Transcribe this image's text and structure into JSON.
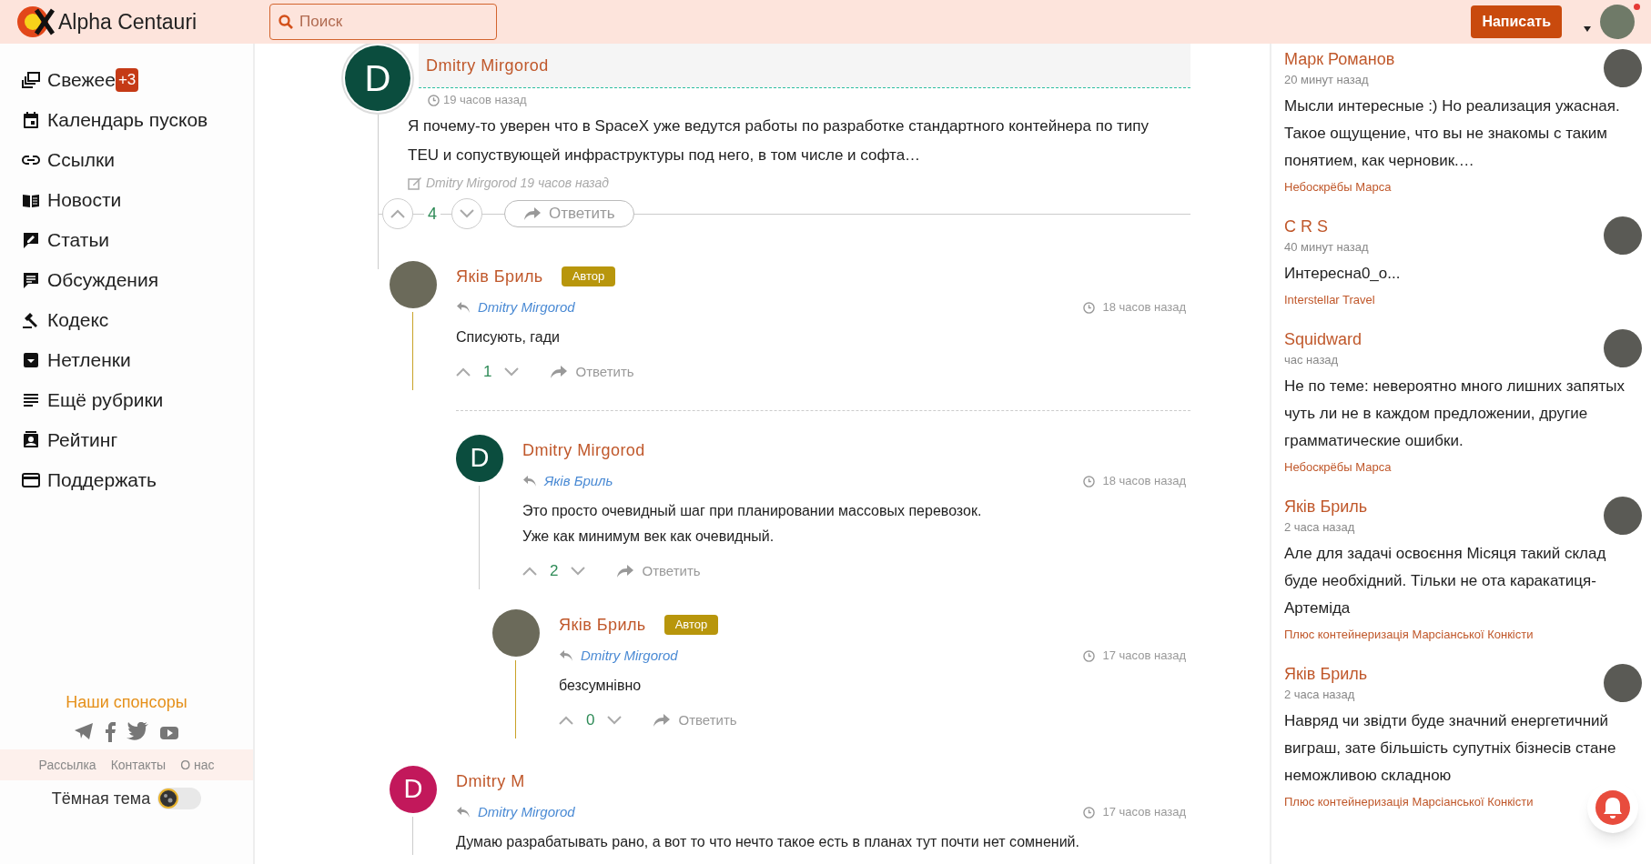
{
  "header": {
    "logo_text": "Alpha Centauri",
    "search": {
      "placeholder": "Поиск"
    },
    "write_button": "Написать",
    "has_notification": true
  },
  "sidebar": {
    "items": [
      {
        "label": "Свежее",
        "badge": "+3"
      },
      {
        "label": "Календарь пусков"
      },
      {
        "label": "Ссылки"
      },
      {
        "label": "Новости"
      },
      {
        "label": "Статьи"
      },
      {
        "label": "Обсуждения"
      },
      {
        "label": "Кодекс"
      },
      {
        "label": "Нетленки"
      },
      {
        "label": "Ещё рубрики"
      },
      {
        "label": "Рейтинг"
      },
      {
        "label": "Поддержать"
      }
    ],
    "sponsors_title": "Наши спонсоры",
    "footer_links": [
      "Рассылка",
      "Контакты",
      "О нас"
    ],
    "dark_theme": {
      "label": "Тёмная тема",
      "on": false
    }
  },
  "comments": [
    {
      "kind": "root",
      "author": "Dmitry Mirgorod",
      "avatar": {
        "kind": "letter",
        "letter": "D",
        "color": "#0b4d3e"
      },
      "time": "19 часов назад",
      "text": "Я почему-то уверен что в SpaceX уже ведутся работы по разработке стандартного контейнера по типу TEU и сопуствующей инфраструктуры под него, в том числе и софта…",
      "edited": "Dmitry Mirgorod 19 часов назад",
      "votes": "4",
      "reply_label": "Ответить",
      "children": [
        {
          "kind": "reply",
          "author": "Яків Бриль",
          "badge": "Автор",
          "avatar": {
            "kind": "photo"
          },
          "reply_to": "Dmitry Mirgorod",
          "time": "18 часов назад",
          "text": "Списують, гади",
          "votes": "1",
          "reply_label": "Ответить",
          "children": [
            {
              "kind": "reply",
              "author": "Dmitry Mirgorod",
              "avatar": {
                "kind": "letter",
                "letter": "D",
                "color": "#0b4d3e"
              },
              "reply_to": "Яків Бриль",
              "time": "18 часов назад",
              "text": "Это просто очевидный шаг при планировании массовых перевозок.\nУже как минимум век как очевидный.",
              "votes": "2",
              "reply_label": "Ответить",
              "children": [
                {
                  "kind": "reply",
                  "author": "Яків Бриль",
                  "badge": "Автор",
                  "avatar": {
                    "kind": "photo"
                  },
                  "reply_to": "Dmitry Mirgorod",
                  "time": "17 часов назад",
                  "text": "безсумнівно",
                  "votes": "0",
                  "reply_label": "Ответить"
                }
              ]
            }
          ]
        },
        {
          "kind": "reply",
          "author": "Dmitry M",
          "avatar": {
            "kind": "letter",
            "letter": "D",
            "color": "#c2185b"
          },
          "reply_to": "Dmitry Mirgorod",
          "time": "17 часов назад",
          "text": "Думаю разрабатывать рано, а вот то что нечто такое есть в планах тут почти нет сомнений."
        }
      ]
    }
  ],
  "recent": [
    {
      "author": "Марк Романов",
      "time": "20 минут назад",
      "text": "Мысли интересные :) Но реализация ужасная. Такое ощущение, что вы не знакомы с таким понятием, как черновик.…",
      "topic": "Небоскрёбы Марса"
    },
    {
      "author": "C R S",
      "time": "40 минут назад",
      "text": "Интересна0_о...",
      "topic": "Interstellar Travel"
    },
    {
      "author": "Squidward",
      "time": "час назад",
      "text": "Не по теме: невероятно много лишних запятых чуть ли не в каждом предложении, другие грамматические ошибки.",
      "topic": "Небоскрёбы Марса"
    },
    {
      "author": "Яків Бриль",
      "time": "2 часа назад",
      "text": "Але для задачі освоєння Місяця такий склад буде необхідний. Тільки не ота каракатиця-Артеміда",
      "topic": "Плюс контейнеризація Марсіанської Конкісти"
    },
    {
      "author": "Яків Бриль",
      "time": "2 часа назад",
      "text": "Навряд чи звідти буде значний енергетичний виграш, зате більшість супутніх бізнесів стане неможливою складною",
      "topic": "Плюс контейнеризація Марсіанської Конкісти"
    }
  ]
}
